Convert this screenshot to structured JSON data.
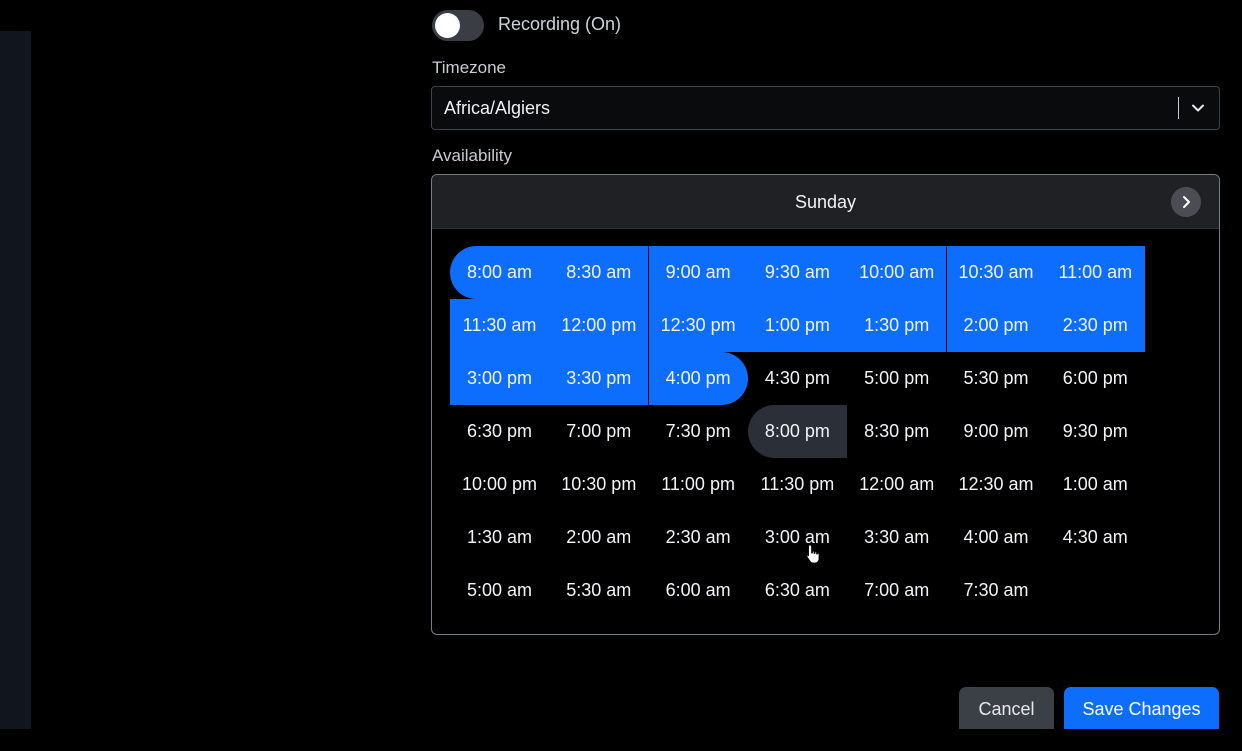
{
  "recording_toggle": {
    "label": "Recording (On)"
  },
  "timezone": {
    "label": "Timezone",
    "value": "Africa/Algiers"
  },
  "availability": {
    "label": "Availability",
    "day": "Sunday",
    "slots": [
      "8:00 am",
      "8:30 am",
      "9:00 am",
      "9:30 am",
      "10:00 am",
      "10:30 am",
      "11:00 am",
      "11:30 am",
      "12:00 pm",
      "12:30 pm",
      "1:00 pm",
      "1:30 pm",
      "2:00 pm",
      "2:30 pm",
      "3:00 pm",
      "3:30 pm",
      "4:00 pm",
      "4:30 pm",
      "5:00 pm",
      "5:30 pm",
      "6:00 pm",
      "6:30 pm",
      "7:00 pm",
      "7:30 pm",
      "8:00 pm",
      "8:30 pm",
      "9:00 pm",
      "9:30 pm",
      "10:00 pm",
      "10:30 pm",
      "11:00 pm",
      "11:30 pm",
      "12:00 am",
      "12:30 am",
      "1:00 am",
      "1:30 am",
      "2:00 am",
      "2:30 am",
      "3:00 am",
      "3:30 am",
      "4:00 am",
      "4:30 am",
      "5:00 am",
      "5:30 am",
      "6:00 am",
      "6:30 am",
      "7:00 am",
      "7:30 am"
    ],
    "selected_range": {
      "start": "8:00 am",
      "end": "4:00 pm"
    },
    "highlighted_slot": "8:00 pm"
  },
  "actions": {
    "cancel": "Cancel",
    "save": "Save Changes"
  },
  "colors": {
    "accent": "#0d6efd",
    "background": "#000000",
    "panel_header": "#1f2125"
  }
}
